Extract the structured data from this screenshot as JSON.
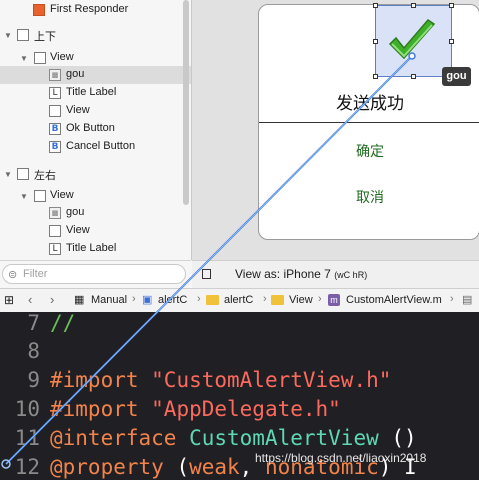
{
  "outline": {
    "items": [
      {
        "label": "First Responder",
        "icon": "first-responder-icon"
      },
      {
        "label": "上下",
        "icon": "scene-icon"
      },
      {
        "label": "View",
        "icon": "view-icon"
      },
      {
        "label": "gou",
        "icon": "image-view-icon"
      },
      {
        "label": "Title Label",
        "icon": "label-icon"
      },
      {
        "label": "View",
        "icon": "view-icon"
      },
      {
        "label": "Ok Button",
        "icon": "button-icon"
      },
      {
        "label": "Cancel Button",
        "icon": "button-icon"
      },
      {
        "label": "左右",
        "icon": "scene-icon"
      },
      {
        "label": "View",
        "icon": "view-icon"
      },
      {
        "label": "gou",
        "icon": "image-view-icon"
      },
      {
        "label": "View",
        "icon": "view-icon"
      },
      {
        "label": "Title Label",
        "icon": "label-icon"
      }
    ],
    "filter_placeholder": "Filter"
  },
  "canvas": {
    "alert_title": "发送成功",
    "ok_label": "确定",
    "cancel_label": "取消",
    "selected_tag": "gou",
    "view_as_label": "View as: iPhone 7",
    "view_as_traits": "(wC hR)"
  },
  "jump_bar": {
    "crumbs": [
      "Manual",
      "alertC",
      "alertC",
      "View",
      "CustomAlertView.m"
    ],
    "file_badge": "m"
  },
  "editor": {
    "lines": [
      {
        "num": "7",
        "tokens": [
          {
            "t": "//",
            "c": "c-comment"
          }
        ]
      },
      {
        "num": "8",
        "tokens": []
      },
      {
        "num": "9",
        "tokens": [
          {
            "t": "#import ",
            "c": "c-kw"
          },
          {
            "t": "\"CustomAlertView.h\"",
            "c": "c-str"
          }
        ]
      },
      {
        "num": "10",
        "tokens": [
          {
            "t": "#import ",
            "c": "c-kw"
          },
          {
            "t": "\"AppDelegate.h\"",
            "c": "c-str"
          }
        ]
      },
      {
        "num": "11",
        "tokens": [
          {
            "t": "@interface ",
            "c": "c-kw"
          },
          {
            "t": "CustomAlertView ",
            "c": "c-type"
          },
          {
            "t": "()",
            "c": "c-plain"
          }
        ]
      },
      {
        "num": "12",
        "tokens": [
          {
            "t": "@property ",
            "c": "c-kw"
          },
          {
            "t": "(",
            "c": "c-plain"
          },
          {
            "t": "weak",
            "c": "c-kw"
          },
          {
            "t": ", ",
            "c": "c-plain"
          },
          {
            "t": "nonatomic",
            "c": "c-kw"
          },
          {
            "t": ") I",
            "c": "c-plain"
          }
        ]
      }
    ],
    "watermark": "https://blog.csdn.net/liaoxin2018"
  },
  "colors": {
    "accent": "#5d7fc4",
    "ok_text": "#1f6b1f",
    "editor_bg": "#1f1f24"
  }
}
